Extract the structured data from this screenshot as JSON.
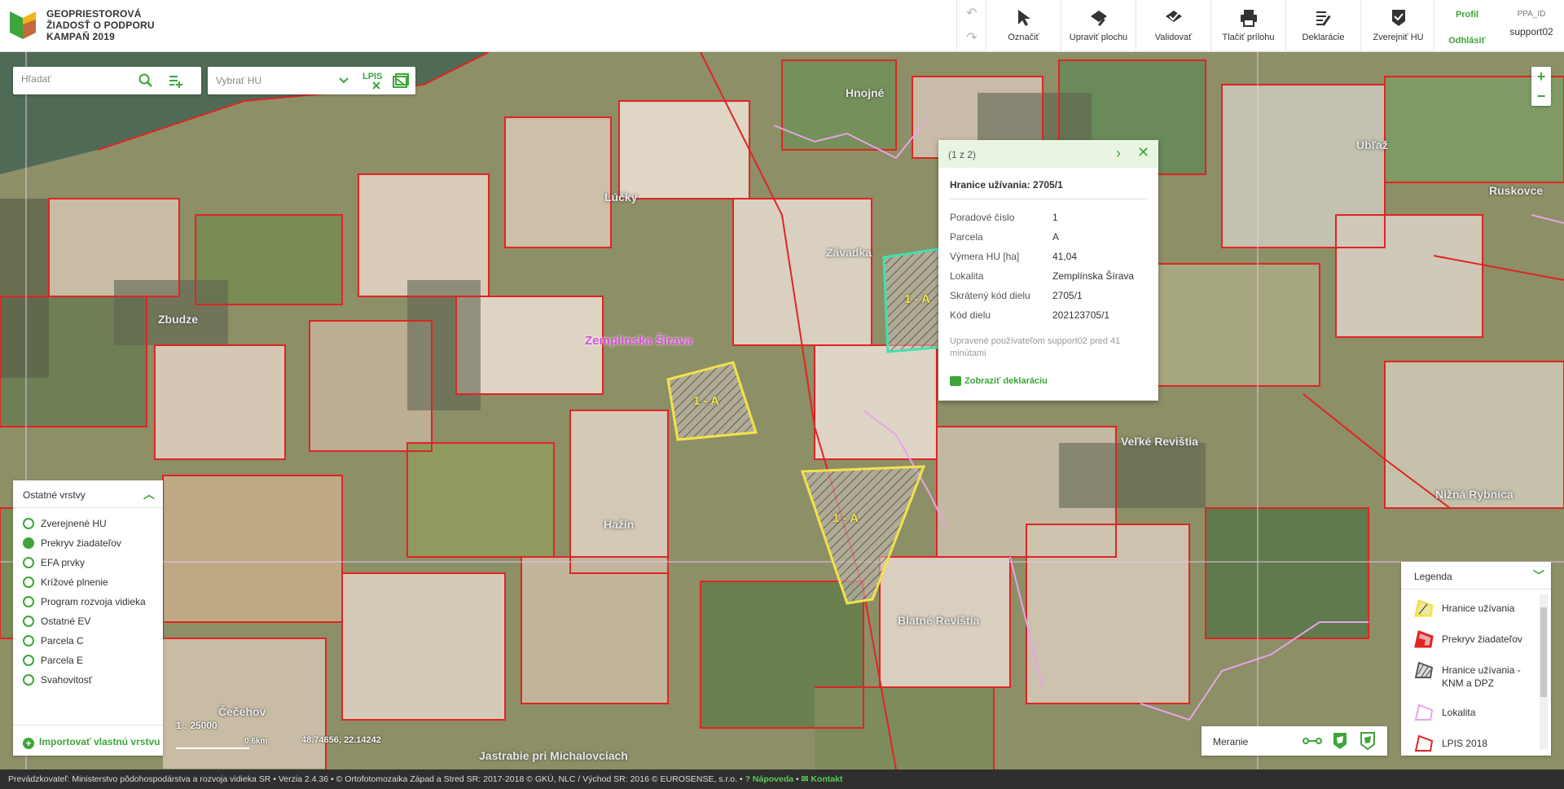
{
  "header": {
    "brand_line1": "GEOPRIESTOROVÁ",
    "brand_line2": "ŽIADOSŤ O PODPORU",
    "brand_line3": "KAMPAŇ 2019",
    "undo_icon": "undo-icon",
    "redo_icon": "redo-icon",
    "tools": [
      {
        "label": "Označiť",
        "icon": "cursor-icon"
      },
      {
        "label": "Upraviť plochu",
        "icon": "edit-area-icon"
      },
      {
        "label": "Validovať",
        "icon": "validate-icon"
      },
      {
        "label": "Tlačiť prílohu",
        "icon": "print-icon"
      },
      {
        "label": "Deklarácie",
        "icon": "declarations-icon"
      },
      {
        "label": "Zverejniť HU",
        "icon": "publish-icon"
      }
    ],
    "profile_label": "Profil",
    "logout_label": "Odhlásiť",
    "ppa_label": "PPA_ID",
    "username": "support02"
  },
  "search": {
    "placeholder": "Hľadať",
    "hu_select_placeholder": "Vybrať HU",
    "lpis_label": "LPIS"
  },
  "zoom": {
    "in": "+",
    "out": "−"
  },
  "map": {
    "places": [
      "Hnojné",
      "Ubľaž",
      "Ruskovce",
      "Lúčky",
      "Závadka",
      "Zbudze",
      "Veľké Revištia",
      "Nižná Rybnica",
      "Hažín",
      "Blatné Revištia",
      "Čečehov",
      "Jastrabie pri Michalovciach"
    ],
    "region_label": "Zemplínska Šírava",
    "parcel_label": "1 - A"
  },
  "popup": {
    "count": "(1 z 2)",
    "title": "Hranice užívania: 2705/1",
    "rows": [
      {
        "key": "Poradové číslo",
        "value": "1"
      },
      {
        "key": "Parcela",
        "value": "A"
      },
      {
        "key": "Výmera HU [ha]",
        "value": "41,04"
      },
      {
        "key": "Lokalita",
        "value": "Zemplínska Šírava"
      },
      {
        "key": "Skrátený kód dielu",
        "value": "2705/1"
      },
      {
        "key": "Kód dielu",
        "value": "202123705/1"
      }
    ],
    "note": "Upravené používateľom support02 pred 41 minútami",
    "link": "Zobraziť deklaráciu"
  },
  "layers": {
    "title": "Ostatné vrstvy",
    "items": [
      {
        "label": "Zverejnené HU",
        "checked": false
      },
      {
        "label": "Prekryv žiadateľov",
        "checked": true
      },
      {
        "label": "EFA prvky",
        "checked": false
      },
      {
        "label": "Krížové plnenie",
        "checked": false
      },
      {
        "label": "Program rozvoja vidieka",
        "checked": false
      },
      {
        "label": "Ostatné EV",
        "checked": false
      },
      {
        "label": "Parcela C",
        "checked": false
      },
      {
        "label": "Parcela E",
        "checked": false
      },
      {
        "label": "Svahovitosť",
        "checked": false
      }
    ],
    "import_label": "Importovať vlastnú vrstvu"
  },
  "scale": {
    "ratio": "1 : 25000",
    "bar_label": "0.6km",
    "coords": "48.74656, 22.14242"
  },
  "measure": {
    "label": "Meranie"
  },
  "legend": {
    "title": "Legenda",
    "items": [
      {
        "label": "Hranice užívania",
        "color": "#f3e24b"
      },
      {
        "label": "Prekryv žiadateľov",
        "color": "#e02424"
      },
      {
        "label": "Hranice užívania - KNM a DPZ",
        "color": "#555555"
      },
      {
        "label": "Lokalita",
        "color": "#e7a4e7"
      },
      {
        "label": "LPIS 2018",
        "color": "#e02424"
      }
    ]
  },
  "footer": {
    "text": "Prevádzkovateľ: Ministerstvo pôdohospodárstva a rozvoja vidieka SR • Verzia 2.4.36 • © Ortofotomozaika Západ a Stred SR: 2017-2018 © GKÚ, NLC / Východ SR: 2016 © EUROSENSE, s.r.o. •",
    "help": "Nápoveda",
    "contact": "Kontakt"
  },
  "colors": {
    "accent": "#3ea53a",
    "parcel_border": "#e02424",
    "selected_yellow": "#f3e24b",
    "selected_teal": "#43e0b0"
  }
}
